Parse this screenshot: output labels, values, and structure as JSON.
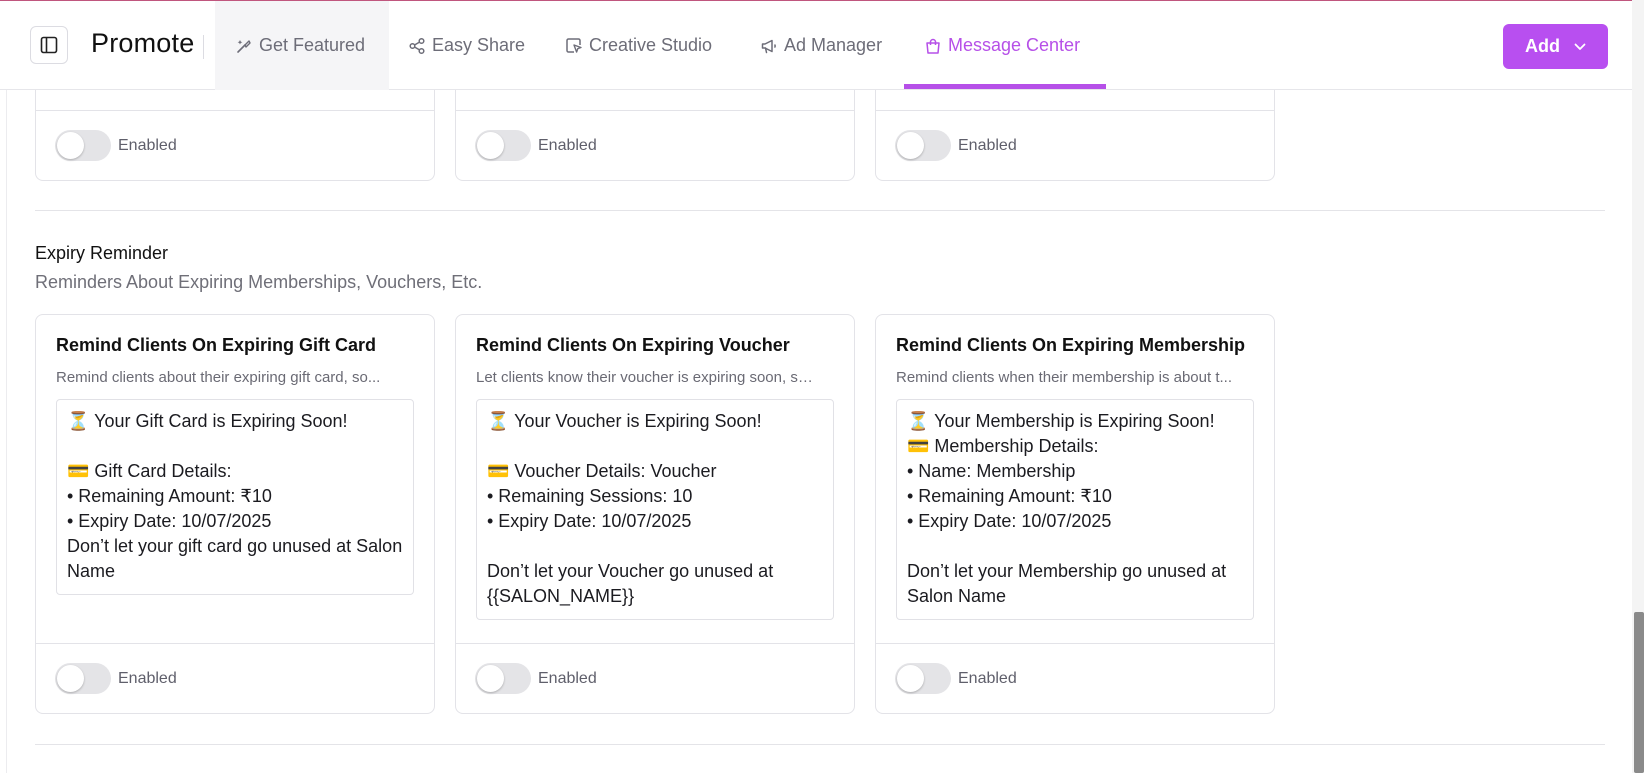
{
  "header": {
    "title": "Promote",
    "tabs": [
      {
        "label": "Get Featured",
        "icon": "sparkle-pen-icon"
      },
      {
        "label": "Easy Share",
        "icon": "share-icon"
      },
      {
        "label": "Creative Studio",
        "icon": "design-cursor-icon"
      },
      {
        "label": "Ad Manager",
        "icon": "megaphone-icon"
      },
      {
        "label": "Message Center",
        "icon": "shopping-bag-icon",
        "active": true
      }
    ],
    "add_label": "Add"
  },
  "colors": {
    "accent": "#b650e8",
    "add_button": "#b84ff0",
    "toggle_off": "#e4e4e7"
  },
  "top_cards": [
    {
      "toggle_label": "Enabled",
      "toggle_on": false
    },
    {
      "toggle_label": "Enabled",
      "toggle_on": false
    },
    {
      "toggle_label": "Enabled",
      "toggle_on": false
    }
  ],
  "expiry_section": {
    "title": "Expiry Reminder",
    "subtitle": "Reminders About Expiring Memberships, Vouchers, Etc.",
    "cards": [
      {
        "title": "Remind Clients On Expiring Gift Card",
        "description": "Remind clients about their expiring gift card, so...",
        "message_lines": [
          "⏳ Your Gift Card is Expiring Soon!",
          "",
          "💳 Gift Card Details:",
          "• Remaining Amount: ₹10",
          "• Expiry Date: 10/07/2025",
          "Don’t let your gift card go unused at Salon Name"
        ],
        "toggle_label": "Enabled",
        "toggle_on": false
      },
      {
        "title": "Remind Clients On Expiring Voucher",
        "description": "Let clients know their voucher is expiring soon, so...",
        "message_lines": [
          "⏳ Your Voucher is Expiring Soon!",
          "",
          "💳 Voucher Details: Voucher",
          "• Remaining Sessions: 10",
          "• Expiry Date: 10/07/2025",
          "",
          "Don’t let your Voucher go unused at {{SALON_NAME}}"
        ],
        "toggle_label": "Enabled",
        "toggle_on": false
      },
      {
        "title": "Remind Clients On Expiring Membership",
        "description": "Remind clients when their membership is about t...",
        "message_lines": [
          "⏳ Your Membership is Expiring Soon!",
          "💳 Membership Details:",
          "• Name: Membership",
          "• Remaining Amount: ₹10",
          "• Expiry Date: 10/07/2025",
          "",
          "Don’t let your Membership go unused at Salon Name"
        ],
        "toggle_label": "Enabled",
        "toggle_on": false
      }
    ]
  }
}
